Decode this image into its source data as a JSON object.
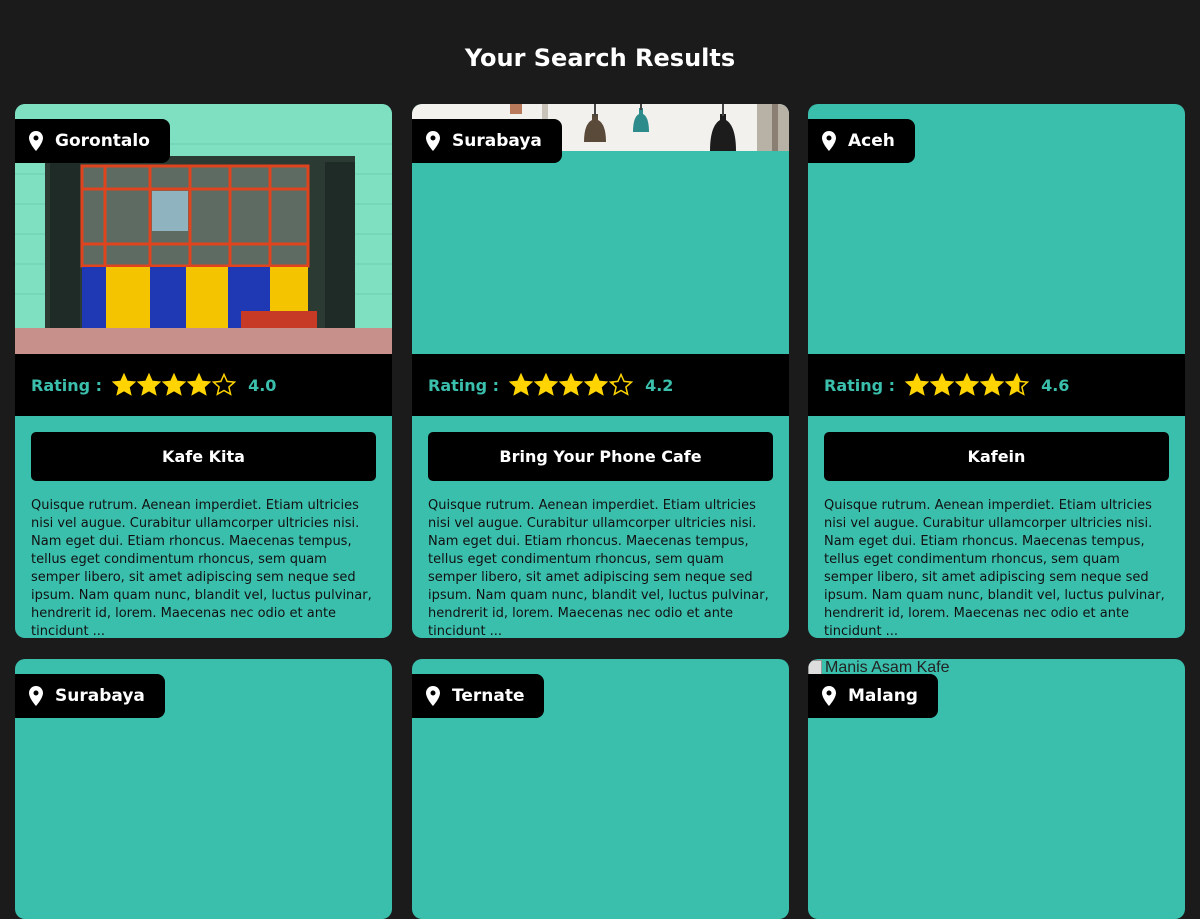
{
  "header": {
    "title": "Your Search Results"
  },
  "theme": {
    "background": "#1b1b1b",
    "card": "#3bbfad",
    "star": "#ffd400",
    "accent": "#3bbfad"
  },
  "rating_label": "Rating :",
  "cards": [
    {
      "location": "Gorontalo",
      "photo": "shopfront-photo",
      "rating": "4.0",
      "rating_stars": 4.0,
      "name": "Kafe Kita",
      "description": "Quisque rutrum. Aenean imperdiet. Etiam ultricies nisi vel augue. Curabitur ullamcorper ultricies nisi. Nam eget dui. Etiam rhoncus. Maecenas tempus, tellus eget condimentum rhoncus, sem quam semper libero, sit amet adipiscing sem neque sed ipsum. Nam quam nunc, blandit vel, luctus pulvinar, hendrerit id, lorem. Maecenas nec odio et ante tincidunt ..."
    },
    {
      "location": "Surabaya",
      "photo": "hanging-lamps-photo",
      "rating": "4.2",
      "rating_stars": 4.2,
      "name": "Bring Your Phone Cafe",
      "description": "Quisque rutrum. Aenean imperdiet. Etiam ultricies nisi vel augue. Curabitur ullamcorper ultricies nisi. Nam eget dui. Etiam rhoncus. Maecenas tempus, tellus eget condimentum rhoncus, sem quam semper libero, sit amet adipiscing sem neque sed ipsum. Nam quam nunc, blandit vel, luctus pulvinar, hendrerit id, lorem. Maecenas nec odio et ante tincidunt ..."
    },
    {
      "location": "Aceh",
      "rating": "4.6",
      "rating_stars": 4.6,
      "name": "Kafein",
      "description": "Quisque rutrum. Aenean imperdiet. Etiam ultricies nisi vel augue. Curabitur ullamcorper ultricies nisi. Nam eget dui. Etiam rhoncus. Maecenas tempus, tellus eget condimentum rhoncus, sem quam semper libero, sit amet adipiscing sem neque sed ipsum. Nam quam nunc, blandit vel, luctus pulvinar, hendrerit id, lorem. Maecenas nec odio et ante tincidunt ..."
    },
    {
      "location": "Surabaya"
    },
    {
      "location": "Ternate"
    },
    {
      "location": "Malang",
      "broken_image_alt": "Manis Asam Kafe"
    }
  ]
}
